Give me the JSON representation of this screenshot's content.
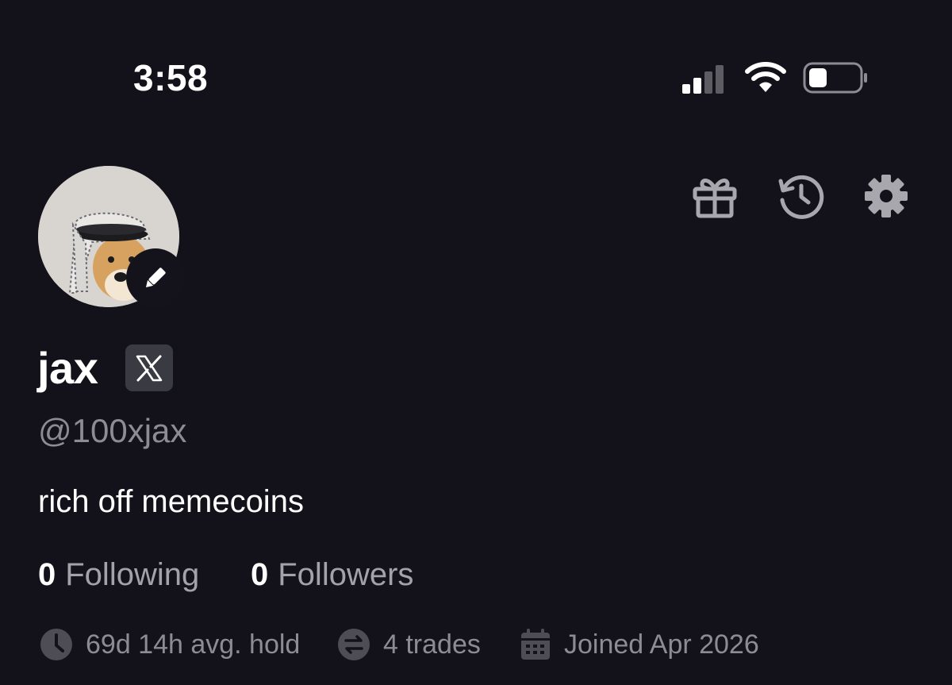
{
  "status_bar": {
    "time": "3:58",
    "icons": [
      "signal-icon",
      "wifi-icon",
      "battery-icon"
    ]
  },
  "header_actions": [
    "gift-icon",
    "history-icon",
    "gear-icon"
  ],
  "profile": {
    "display_name": "jax",
    "handle": "@100xjax",
    "bio": "rich off memecoins",
    "following": {
      "count": "0",
      "label": "Following"
    },
    "followers": {
      "count": "0",
      "label": "Followers"
    },
    "stats": {
      "avg_hold": "69d 14h avg. hold",
      "trades": "4 trades",
      "joined": "Joined Apr 2026"
    }
  },
  "colors": {
    "background": "#13121a",
    "primary_text": "#ffffff",
    "secondary_text": "#8d8c94",
    "icon_gray": "#a8a7ae",
    "badge_bg": "#3a3a42"
  }
}
